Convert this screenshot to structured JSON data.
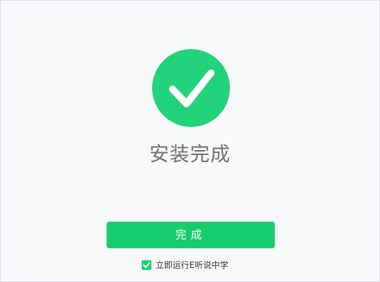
{
  "window": {
    "background": "#f8f9fb"
  },
  "status": {
    "icon": "check-circle-icon",
    "title": "安装完成",
    "accent": "#21d37a"
  },
  "actions": {
    "finish_label": "完成"
  },
  "options": {
    "run_after_install": {
      "checked": true,
      "label": "立即运行E听说中学"
    }
  }
}
